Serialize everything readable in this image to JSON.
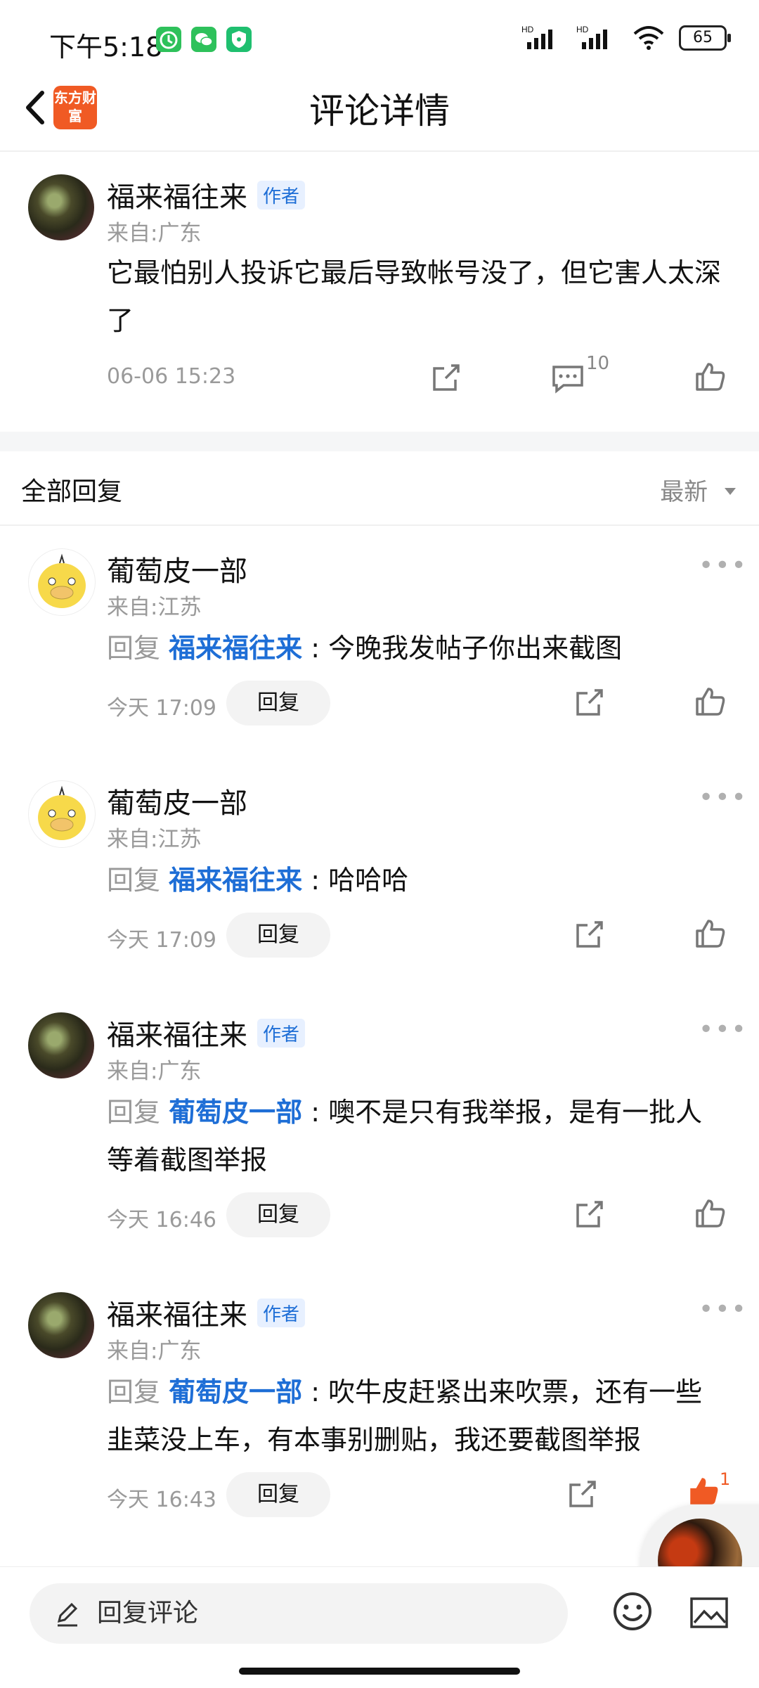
{
  "status_bar": {
    "time": "下午5:18",
    "battery": "65",
    "hd1": "HD",
    "hd2": "HD"
  },
  "header": {
    "title": "评论详情",
    "logo_text": "东方财富"
  },
  "main_comment": {
    "author": "福来福往来",
    "author_tag": "作者",
    "location": "来自:广东",
    "content": "它最怕别人投诉它最后导致帐号没了，但它害人太深了",
    "time": "06-06 15:23",
    "comment_count": "10"
  },
  "replies_section": {
    "title": "全部回复",
    "sort": "最新"
  },
  "replies": [
    {
      "author": "葡萄皮一部",
      "location": "来自:江苏",
      "prefix": "回复",
      "target": "福来福往来",
      "text": "今晚我发帖子你出来截图",
      "time": "今天 17:09",
      "reply_btn": "回复"
    },
    {
      "author": "葡萄皮一部",
      "location": "来自:江苏",
      "prefix": "回复",
      "target": "福来福往来",
      "text": "哈哈哈",
      "time": "今天 17:09",
      "reply_btn": "回复"
    },
    {
      "author": "福来福往来",
      "author_tag": "作者",
      "location": "来自:广东",
      "prefix": "回复",
      "target": "葡萄皮一部",
      "text": "噢不是只有我举报，是有一批人等着截图举报",
      "time": "今天 16:46",
      "reply_btn": "回复"
    },
    {
      "author": "福来福往来",
      "author_tag": "作者",
      "location": "来自:广东",
      "prefix": "回复",
      "target": "葡萄皮一部",
      "text": "吹牛皮赶紧出来吹票，还有一些韭菜没上车，有本事别删贴，我还要截图举报",
      "time": "今天 16:43",
      "reply_btn": "回复",
      "likes": "1"
    }
  ],
  "bottom": {
    "input_placeholder": "回复评论"
  },
  "colors": {
    "accent": "#1e6ed6",
    "like_active": "#f05a24"
  }
}
